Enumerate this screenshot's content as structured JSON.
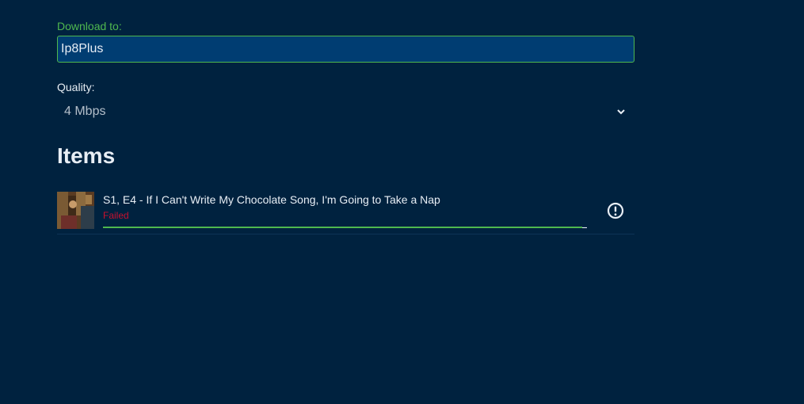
{
  "download": {
    "label": "Download to:",
    "value": "Ip8Plus",
    "accent_color": "#4fb84f"
  },
  "quality": {
    "label": "Quality:",
    "selected": "4 Mbps",
    "icon": "chevron-down-icon"
  },
  "items_section": {
    "heading": "Items",
    "items": [
      {
        "title": "S1, E4 - If I Can't Write My Chocolate Song, I'm Going to Take a Nap",
        "status": "Failed",
        "status_color": "#c8102e",
        "progress": 0.99,
        "icon": "error-icon"
      }
    ]
  }
}
